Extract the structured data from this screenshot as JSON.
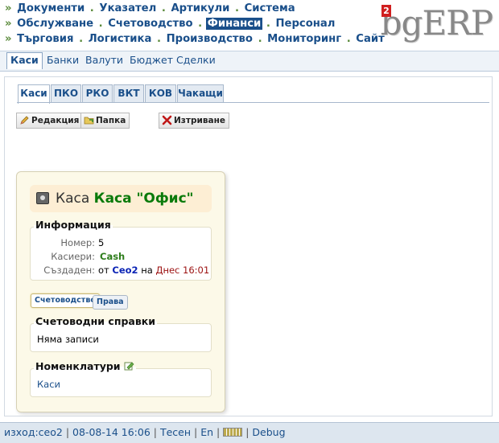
{
  "header": {
    "menu_row1": [
      {
        "label": "Документи",
        "active": false
      },
      {
        "label": "Указател",
        "active": false
      },
      {
        "label": "Артикули",
        "active": false
      },
      {
        "label": "Система",
        "active": false
      }
    ],
    "menu_row2": [
      {
        "label": "Обслужване",
        "active": false
      },
      {
        "label": "Счетоводство",
        "active": false
      },
      {
        "label": "Финанси",
        "active": true
      },
      {
        "label": "Персонал",
        "active": false
      }
    ],
    "menu_row3": [
      {
        "label": "Търговия",
        "active": false
      },
      {
        "label": "Логистика",
        "active": false
      },
      {
        "label": "Производство",
        "active": false
      },
      {
        "label": "Мониторинг",
        "active": false
      },
      {
        "label": "Сайт",
        "active": false
      }
    ],
    "bullet": "»",
    "separator": ".",
    "logo": {
      "text": "bgERP",
      "badge": "2"
    }
  },
  "submenu": {
    "items": [
      "Каси",
      "Банки",
      "Валути",
      "Бюджет",
      "Сделки"
    ],
    "selected": "Каси"
  },
  "tabs": {
    "items": [
      "Каси",
      "ПКО",
      "РКО",
      "ВКТ",
      "КОВ",
      "Чакащи"
    ],
    "active": "Каси"
  },
  "toolbar": {
    "edit_label": "Редакция",
    "folder_label": "Папка",
    "delete_label": "Изтриване"
  },
  "record": {
    "title_kind": "Каса",
    "title_name": "Каса \"Офис\"",
    "info": {
      "legend": "Информация",
      "number_label": "Номер:",
      "number_value": "5",
      "cashiers_label": "Касиери:",
      "cashiers_value": "Cash",
      "created_label": "Създаден:",
      "created_from": "от",
      "created_user": "Ceo2",
      "created_on": "на",
      "created_time": "Днес 16:01"
    },
    "subtabs": [
      "Счетоводство",
      "Права"
    ],
    "active_subtab": "Счетоводство",
    "reports": {
      "legend": "Счетоводни справки",
      "text": "Няма записи"
    },
    "nomenclatures": {
      "legend": "Номенклатури",
      "link": "Каси"
    }
  },
  "footer": {
    "user": "изход:ceo2",
    "datetime": "08-08-14 16:06",
    "mode": "Тесен",
    "lang": "En",
    "debug": "Debug"
  },
  "colors": {
    "link": "#1a4f8a",
    "active_menu_bg": "#1a4f8a",
    "title_green": "#0a7a0a",
    "cashier_green": "#2e7d1c",
    "user_blue": "#0b24b5",
    "date_red": "#9b1010"
  }
}
